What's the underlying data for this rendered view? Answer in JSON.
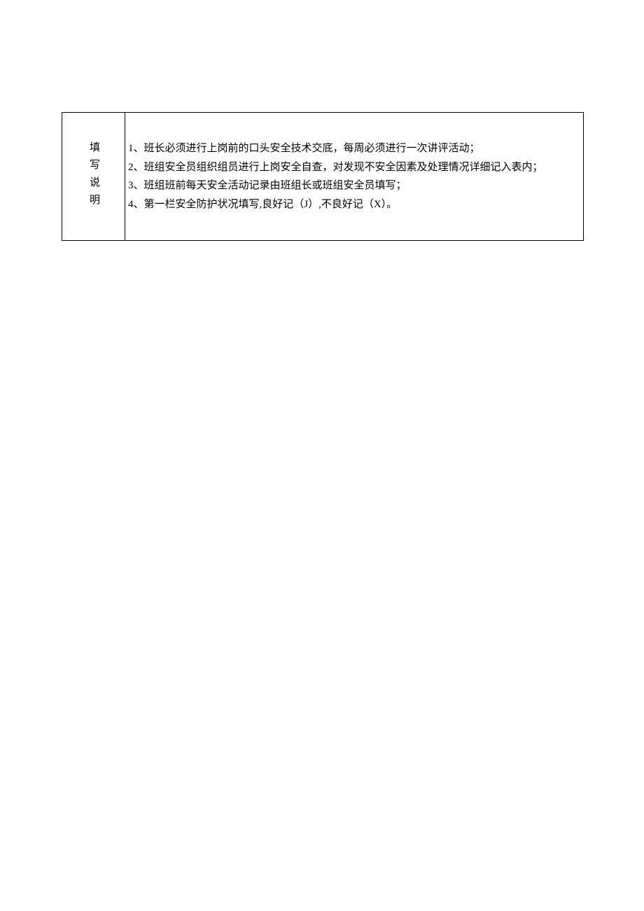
{
  "table": {
    "rowHeader": "填写说明",
    "lines": [
      "1、班长必须进行上岗前的口头安全技术交底，每周必须进行一次讲评活动；",
      "2、班组安全员组织组员进行上岗安全自查，对发现不安全因素及处理情况详细记入表内；",
      "3、班组班前每天安全活动记录由班组长或班组安全员填写；",
      "4、第一栏安全防护状况填写,良好记（J）,不良好记（X）。"
    ]
  }
}
